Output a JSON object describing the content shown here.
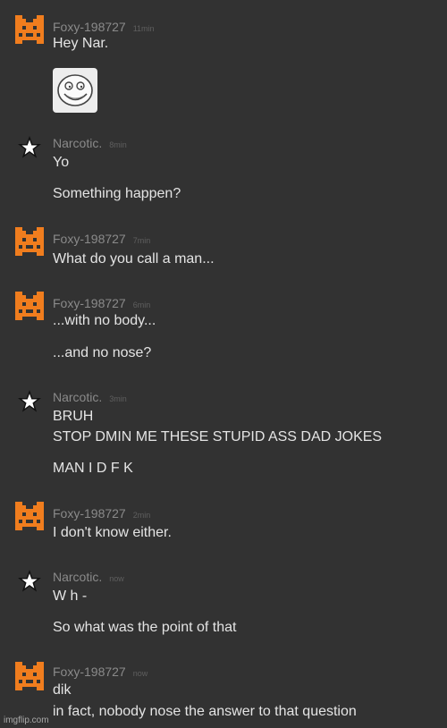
{
  "messages": [
    {
      "user": "Foxy-198727",
      "time": "11min",
      "avatar_icon": "orange-pixel-fox-icon",
      "lines": [
        "Hey Nar."
      ],
      "sticker_icon": "trollface-sticker"
    },
    {
      "user": "Narcotic.",
      "time": "8min",
      "avatar_icon": "star-icon",
      "lines": [
        "Yo",
        "Something happen?"
      ]
    },
    {
      "user": "Foxy-198727",
      "time": "7min",
      "avatar_icon": "orange-pixel-fox-icon",
      "lines": [
        "What do you call a man..."
      ]
    },
    {
      "user": "Foxy-198727",
      "time": "6min",
      "avatar_icon": "orange-pixel-fox-icon",
      "lines": [
        "...with no body...",
        "...and no nose?"
      ]
    },
    {
      "user": "Narcotic.",
      "time": "3min",
      "avatar_icon": "star-icon",
      "lines": [
        "BRUH",
        "STOP DMIN ME THESE STUPID ASS DAD JOKES",
        "MAN I D F K"
      ]
    },
    {
      "user": "Foxy-198727",
      "time": "2min",
      "avatar_icon": "orange-pixel-fox-icon",
      "lines": [
        "I don't know either."
      ]
    },
    {
      "user": "Narcotic.",
      "time": "now",
      "avatar_icon": "star-icon",
      "lines": [
        "W h -",
        "So what was the point of that"
      ]
    },
    {
      "user": "Foxy-198727",
      "time": "now",
      "avatar_icon": "orange-pixel-fox-icon",
      "lines": [
        "dik",
        "in fact, nobody nose the answer to that question"
      ]
    }
  ],
  "watermark": "imgflip.com",
  "colors": {
    "background": "#323232",
    "fox_orange": "#f07d1e",
    "username": "#8a8a8a",
    "message_text": "#e4e4e4"
  }
}
